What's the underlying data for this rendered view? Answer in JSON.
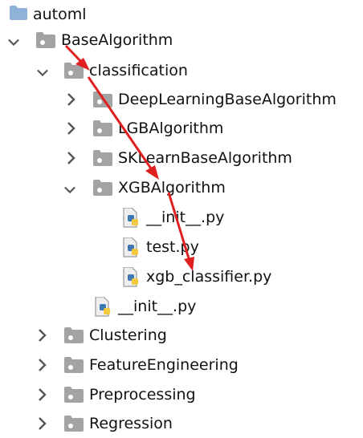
{
  "tree": {
    "items": [
      {
        "label": "automl",
        "icon": "folder-icon",
        "expanded": null
      },
      {
        "label": "BaseAlgorithm",
        "icon": "package-folder-icon",
        "expanded": true
      },
      {
        "label": "classification",
        "icon": "package-folder-icon",
        "expanded": true
      },
      {
        "label": "DeepLearningBaseAlgorithm",
        "icon": "package-folder-icon",
        "expanded": false
      },
      {
        "label": "LGBAlgorithm",
        "icon": "package-folder-icon",
        "expanded": false
      },
      {
        "label": "SKLearnBaseAlgorithm",
        "icon": "package-folder-icon",
        "expanded": false
      },
      {
        "label": "XGBAlgorithm",
        "icon": "package-folder-icon",
        "expanded": true
      },
      {
        "label": "__init__.py",
        "icon": "python-file-icon",
        "expanded": null
      },
      {
        "label": "test.py",
        "icon": "python-file-icon",
        "expanded": null
      },
      {
        "label": "xgb_classifier.py",
        "icon": "python-file-icon",
        "expanded": null
      },
      {
        "label": "__init__.py",
        "icon": "python-file-icon",
        "expanded": null
      },
      {
        "label": "Clustering",
        "icon": "package-folder-icon",
        "expanded": false
      },
      {
        "label": "FeatureEngineering",
        "icon": "package-folder-icon",
        "expanded": false
      },
      {
        "label": "Preprocessing",
        "icon": "package-folder-icon",
        "expanded": false
      },
      {
        "label": "Regression",
        "icon": "package-folder-icon",
        "expanded": false
      }
    ]
  },
  "colors": {
    "folder_blue": "#8fb3d8",
    "package_grey": "#a3a3a3",
    "python_blue": "#3f76b4",
    "python_yellow": "#f3c93f",
    "chevron": "#555555",
    "annotation_arrow": "#e02020"
  }
}
